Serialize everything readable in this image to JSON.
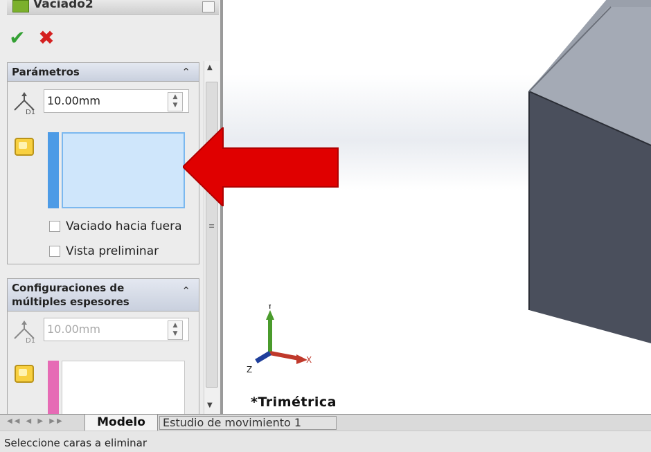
{
  "property_manager": {
    "feature_title": "Vaciado2",
    "ok_symbol": "✔",
    "cancel_symbol": "✖",
    "parameters_group": {
      "header": "Parámetros",
      "thickness_value": "10.00mm",
      "faces_selected": [],
      "shell_outward_label": "Vaciado hacia fuera",
      "shell_outward_checked": false,
      "preview_label": "Vista preliminar",
      "preview_checked": false
    },
    "multi_thickness_group": {
      "header_line1": "Configuraciones de",
      "header_line2": "múltiples espesores",
      "thickness_value": "10.00mm"
    }
  },
  "viewport": {
    "view_name": "*Trimétrica",
    "triad": {
      "x": "X",
      "y": "Y",
      "z": "Z"
    }
  },
  "tabs": {
    "model": "Modelo",
    "motion_study": "Estudio de movimiento 1"
  },
  "status": {
    "message": "Seleccione caras a eliminar"
  },
  "colors": {
    "selection_blue": "#4d9be6",
    "selection_box_fill": "#cfe6fb",
    "selection_pink": "#e66bb5",
    "arrow_red": "#e00000",
    "cube_front": "#4a4f5c",
    "cube_top": "#9aa0ab",
    "ok_green": "#33a033",
    "cancel_red": "#d42020"
  },
  "icons": [
    "feature-shell-icon",
    "checkmark-icon",
    "close-icon",
    "thickness-icon",
    "face-select-icon",
    "collapse-chevron-icon",
    "scroll-up-icon",
    "scroll-down-icon"
  ]
}
